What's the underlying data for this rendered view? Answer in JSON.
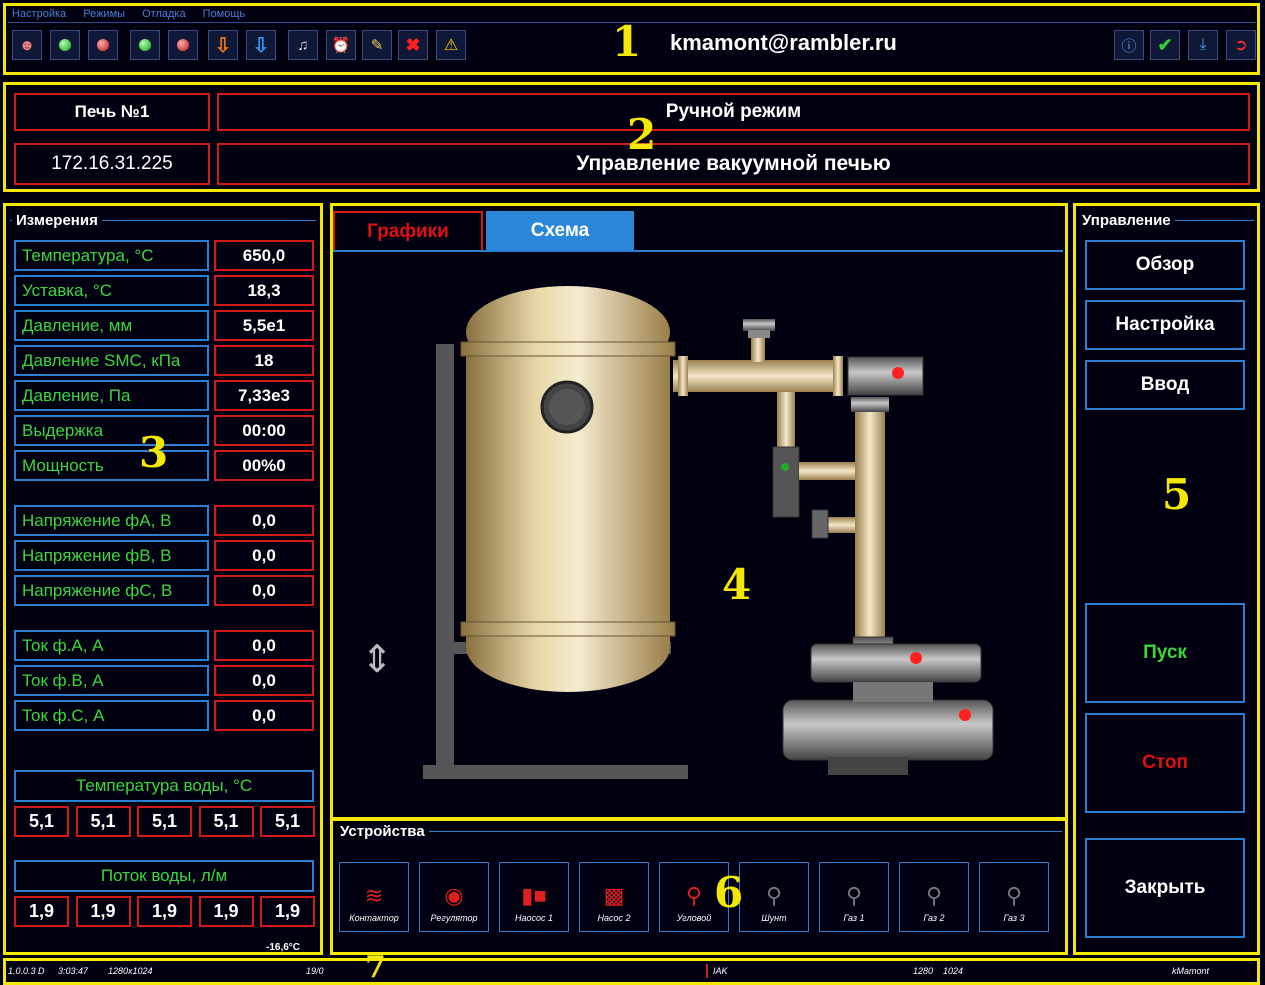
{
  "menu": [
    "Настройка",
    "Режимы",
    "Отладка",
    "Помощь"
  ],
  "toolbar": {
    "email": "kmamont@rambler.ru",
    "icons": [
      "user-icon",
      "green-led-icon",
      "red-led-icon",
      "green-led-icon",
      "red-led-icon",
      "arrow-down-icon",
      "arrow-down-icon",
      "music-icon",
      "alarm-clock-icon",
      "note-icon",
      "close-icon",
      "warning-icon"
    ],
    "right_icons": [
      "info-icon",
      "check-icon",
      "download-icon",
      "exit-icon"
    ]
  },
  "annotations": [
    "1",
    "2",
    "3",
    "4",
    "5",
    "6",
    "7"
  ],
  "header": {
    "furnace": "Печь №1",
    "mode": "Ручной режим",
    "ip": "172.16.31.225",
    "title": "Управление вакуумной печью"
  },
  "measurements": {
    "legend": "Измерения",
    "rows": [
      {
        "label": "Температура, °С",
        "value": "650,0"
      },
      {
        "label": "Уставка, °С",
        "value": "18,3"
      },
      {
        "label": "Давление, мм",
        "value": "5,5е1"
      },
      {
        "label": "Давление SMC, кПа",
        "value": "18"
      },
      {
        "label": "Давление, Па",
        "value": "7,33е3"
      },
      {
        "label": "Выдержка",
        "value": "00:00"
      },
      {
        "label": "Мощность",
        "value": "00%0"
      }
    ],
    "voltage": [
      {
        "label": "Напряжение фА, В",
        "value": "0,0"
      },
      {
        "label": "Напряжение фВ, В",
        "value": "0,0"
      },
      {
        "label": "Напряжение фС, В",
        "value": "0,0"
      }
    ],
    "current": [
      {
        "label": "Ток ф.А, А",
        "value": "0,0"
      },
      {
        "label": "Ток ф.В, А",
        "value": "0,0"
      },
      {
        "label": "Ток ф.С, А",
        "value": "0,0"
      }
    ],
    "water_temp_label": "Температура воды, °С",
    "water_temp": [
      "5,1",
      "5,1",
      "5,1",
      "5,1",
      "5,1"
    ],
    "water_flow_label": "Поток воды, л/м",
    "water_flow": [
      "1,9",
      "1,9",
      "1,9",
      "1,9",
      "1,9"
    ],
    "ambient": "-16,6°С"
  },
  "tabs": [
    {
      "label": "Графики",
      "color": "#e01010"
    },
    {
      "label": "Схема",
      "color": "#ffffff"
    }
  ],
  "devices": {
    "legend": "Устройства",
    "items": [
      {
        "label": "Контактор",
        "active": true
      },
      {
        "label": "Регулятор",
        "active": true
      },
      {
        "label": "Наосос 1",
        "active": true
      },
      {
        "label": "Насос 2",
        "active": true
      },
      {
        "label": "Угловой",
        "active": true
      },
      {
        "label": "Шунт",
        "active": false
      },
      {
        "label": "Газ 1",
        "active": false
      },
      {
        "label": "Газ 2",
        "active": false
      },
      {
        "label": "Газ 3",
        "active": false
      }
    ]
  },
  "control": {
    "legend": "Управление",
    "overview": "Обзор",
    "settings": "Настройка",
    "input": "Ввод",
    "start": "Пуск",
    "stop": "Стоп",
    "close": "Закрыть"
  },
  "statusbar": {
    "version": "1.0.0.3 D",
    "time": "3:03:47",
    "res": "1280x1024",
    "count": "19/0",
    "iak": "IAK",
    "w": "1280",
    "h": "1024",
    "author": "kMamont"
  },
  "colors": {
    "accent": "#2b7fd0",
    "highlight": "#f5e800",
    "alert": "#d01a1a",
    "ok": "#3cd63c"
  }
}
